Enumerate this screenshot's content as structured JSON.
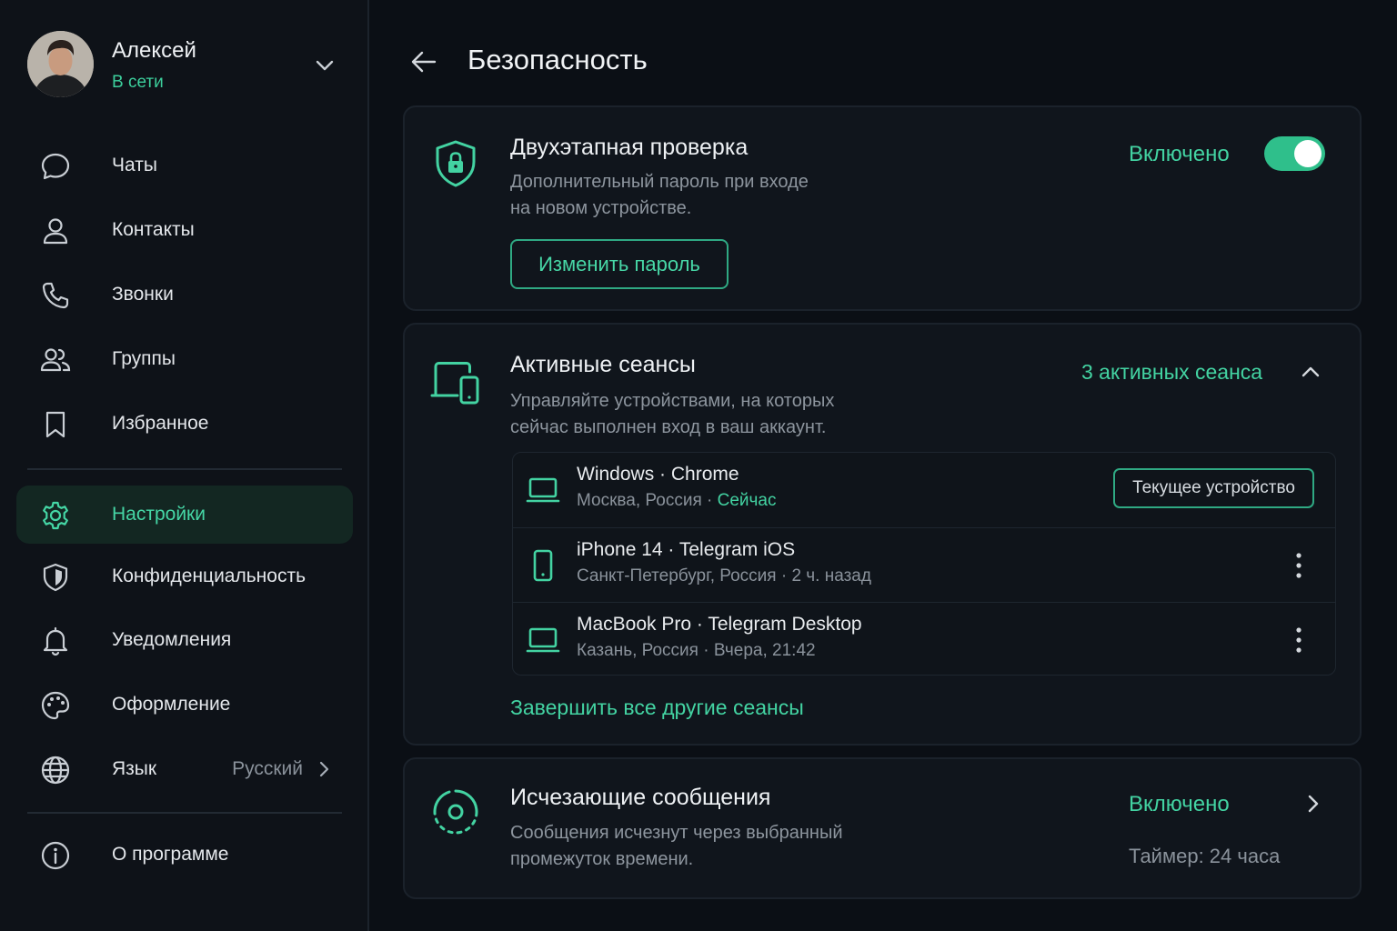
{
  "profile": {
    "name": "Алексей",
    "status": "В сети"
  },
  "nav": {
    "chats": "Чаты",
    "contacts": "Контакты",
    "calls": "Звонки",
    "groups": "Группы",
    "favorites": "Избранное",
    "settings": "Настройки",
    "privacy": "Конфиденциальность",
    "notifications": "Уведомления",
    "appearance": "Оформление",
    "language": "Язык",
    "language_value": "Русский",
    "about": "О программе"
  },
  "header": {
    "title": "Безопасность"
  },
  "two_step": {
    "title": "Двухэтапная проверка",
    "desc_line1": "Дополнительный пароль при входе",
    "desc_line2": "на новом устройстве.",
    "status": "Включено",
    "enabled": true,
    "change_password": "Изменить пароль"
  },
  "sessions": {
    "title": "Активные сеансы",
    "desc_line1": "Управляйте устройствами, на которых",
    "desc_line2": "сейчас выполнен вход в ваш аккаунт.",
    "count_label": "3 активных сеанса",
    "items": [
      {
        "device": "Windows · Chrome",
        "location": "Москва, Россия · ",
        "time": "Сейчас",
        "badge": "Текущее устройство",
        "icon": "laptop-icon"
      },
      {
        "device": "iPhone 14 · Telegram iOS",
        "location": "Санкт-Петербург, Россия · 2 ч. назад",
        "icon": "phone-icon"
      },
      {
        "device": "MacBook Pro · Telegram Desktop",
        "location": "Казань, Россия · Вчера, 21:42",
        "icon": "laptop-icon"
      }
    ],
    "terminate_all": "Завершить все другие сеансы"
  },
  "disappearing": {
    "title": "Исчезающие сообщения",
    "desc_line1": "Сообщения исчезнут через выбранный",
    "desc_line2": "промежуток времени.",
    "status": "Включено",
    "timer": "Таймер: 24 часа"
  },
  "colors": {
    "accent": "#43d3a2",
    "background": "#0b0f15",
    "card": "#10151c"
  }
}
